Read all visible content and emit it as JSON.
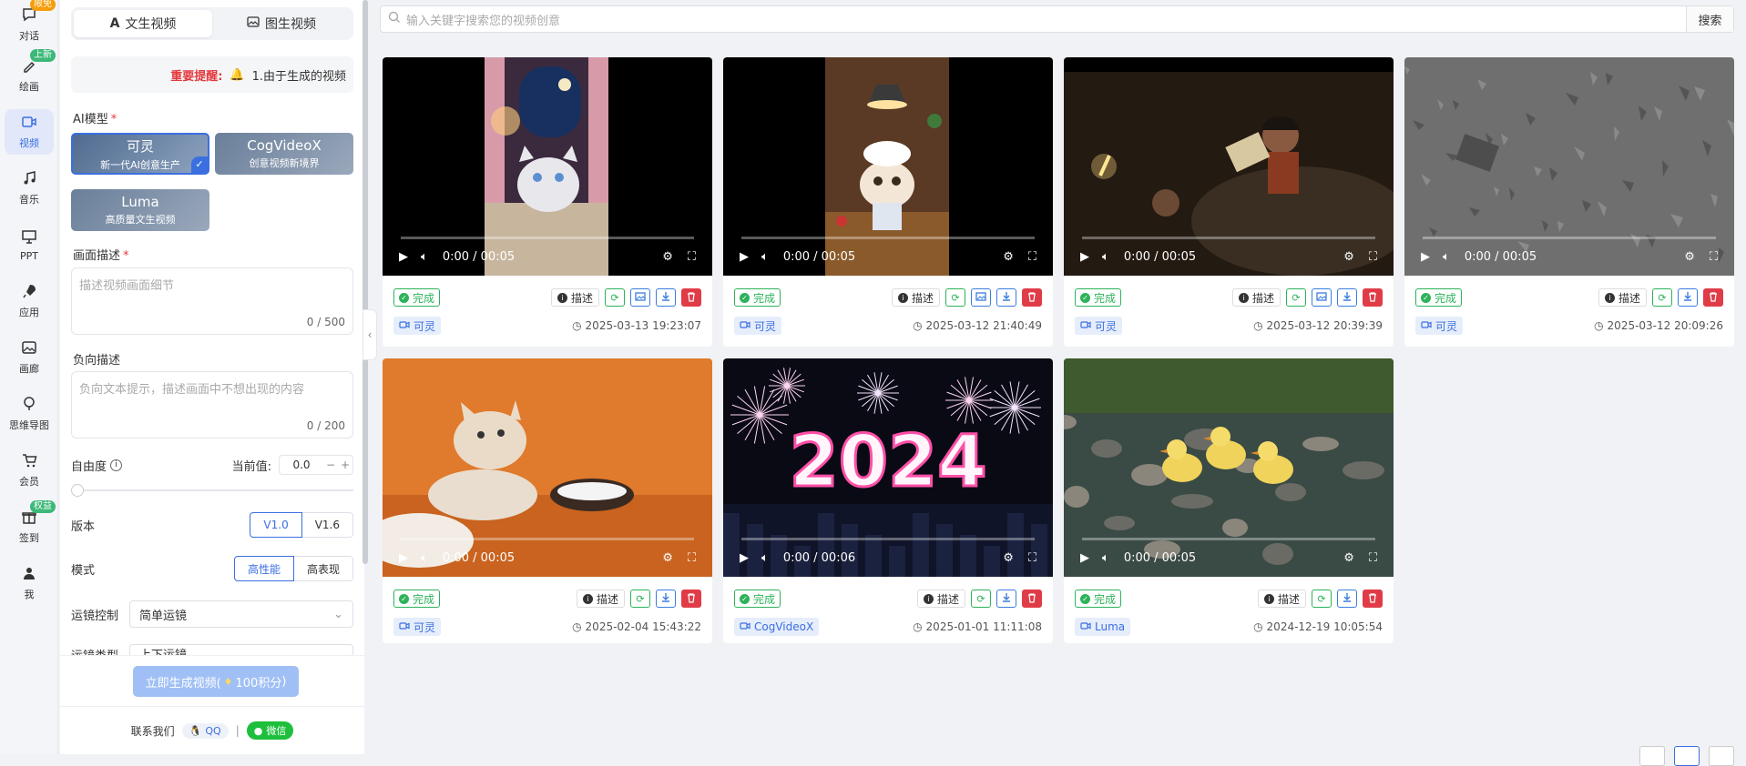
{
  "nav": {
    "items": [
      {
        "label": "对话",
        "badge": "限免",
        "badge_color": "#f59e0b",
        "icon": "chat-icon"
      },
      {
        "label": "绘画",
        "badge": "上新",
        "badge_color": "#3cb878",
        "icon": "paint-icon"
      },
      {
        "label": "视频",
        "badge": "",
        "icon": "video-icon",
        "active": true
      },
      {
        "label": "音乐",
        "badge": "",
        "icon": "music-icon"
      },
      {
        "label": "PPT",
        "badge": "",
        "icon": "ppt-icon"
      },
      {
        "label": "应用",
        "badge": "",
        "icon": "rocket-icon"
      },
      {
        "label": "画廊",
        "badge": "",
        "icon": "gallery-icon"
      },
      {
        "label": "思维导图",
        "badge": "",
        "icon": "mindmap-icon"
      },
      {
        "label": "会员",
        "badge": "",
        "icon": "cart-icon"
      },
      {
        "label": "签到",
        "badge": "权益",
        "badge_color": "#3cb878",
        "icon": "gift-icon"
      },
      {
        "label": "我",
        "badge": "",
        "icon": "user-icon"
      }
    ]
  },
  "panel": {
    "tabs": [
      {
        "label": "文生视频",
        "icon": "text-icon",
        "active": true
      },
      {
        "label": "图生视频",
        "icon": "image-icon",
        "active": false
      }
    ],
    "notice_label": "重要提醒:",
    "notice_text": "1.由于生成的视频",
    "ai_model_label": "AI模型",
    "models": [
      {
        "name": "可灵",
        "desc": "新一代AI创意生产",
        "selected": true
      },
      {
        "name": "CogVideoX",
        "desc": "创意视频新境界",
        "selected": false
      },
      {
        "name": "Luma",
        "desc": "高质量文生视频",
        "selected": false
      }
    ],
    "prompt_label": "画面描述",
    "prompt_placeholder": "描述视频画面细节",
    "prompt_count": "0 / 500",
    "neg_label": "负向描述",
    "neg_placeholder": "负向文本提示，描述画面中不想出现的内容",
    "neg_count": "0 / 200",
    "freedom_label": "自由度",
    "current_label": "当前值:",
    "current_value": "0.0",
    "freedom_value": 0,
    "version_label": "版本",
    "versions": [
      "V1.0",
      "V1.6"
    ],
    "version_selected": "V1.0",
    "mode_label": "模式",
    "modes": [
      "高性能",
      "高表现"
    ],
    "mode_selected": "高性能",
    "camera_label": "运镜控制",
    "camera_value": "简单运镜",
    "camera_type_label": "运镜类型",
    "camera_type_value": "上下运镜",
    "generate_label": "立即生成视频(",
    "generate_cost": "100积分",
    "generate_close": ")",
    "contact_label": "联系我们",
    "qq_label": "QQ",
    "wechat_label": "微信",
    "divider": "|"
  },
  "search": {
    "placeholder": "输入关键字搜索您的视频创意",
    "button": "搜索"
  },
  "videos": [
    {
      "time": "0:00 / 00:05",
      "status": "完成",
      "desc": "描述",
      "model": "可灵",
      "date": "2025-03-13 19:23:07",
      "has_image_btn": true,
      "scene": "kitten-writing"
    },
    {
      "time": "0:00 / 00:05",
      "status": "完成",
      "desc": "描述",
      "model": "可灵",
      "date": "2025-03-12 21:40:49",
      "has_image_btn": true,
      "scene": "chef-kitten"
    },
    {
      "time": "0:00 / 00:05",
      "status": "完成",
      "desc": "描述",
      "model": "可灵",
      "date": "2025-03-12 20:39:39",
      "has_image_btn": true,
      "scene": "kids-night"
    },
    {
      "time": "0:00 / 00:05",
      "status": "完成",
      "desc": "描述",
      "model": "可灵",
      "date": "2025-03-12 20:09:26",
      "has_image_btn": false,
      "scene": "grey-texture"
    },
    {
      "time": "0:00 / 00:05",
      "status": "完成",
      "desc": "描述",
      "model": "可灵",
      "date": "2025-02-04 15:43:22",
      "has_image_btn": false,
      "scene": "kitten-bowl"
    },
    {
      "time": "0:00 / 00:06",
      "status": "完成",
      "desc": "描述",
      "model": "CogVideoX",
      "date": "2025-01-01 11:11:08",
      "has_image_btn": false,
      "scene": "fireworks-2024",
      "overlay_text": "2024"
    },
    {
      "time": "0:00 / 00:05",
      "status": "完成",
      "desc": "描述",
      "model": "Luma",
      "date": "2024-12-19 10:05:54",
      "has_image_btn": false,
      "scene": "ducklings"
    }
  ],
  "colors": {
    "accent": "#3b6fe0",
    "success": "#2cb35a",
    "danger": "#e03c48"
  }
}
